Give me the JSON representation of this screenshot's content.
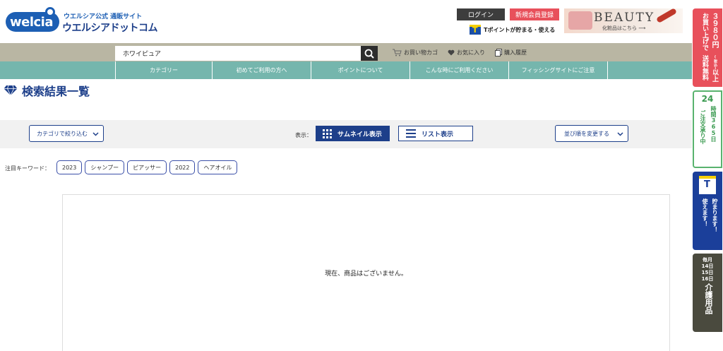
{
  "header": {
    "logo_text": "welcia",
    "logo_sub": "ウエルシア公式 通販サイト",
    "logo_main": "ウエルシアドットコム",
    "login_label": "ログイン",
    "register_label": "新規会員登録",
    "tpoint_text": "Tポイントが貯まる・使える",
    "beauty_title": "BEAUTY",
    "beauty_sub": "化粧品はこちら ⟶"
  },
  "search": {
    "value": "ホワイピュア"
  },
  "header_links": {
    "cart": "お買い物カゴ",
    "favorites": "お気に入り",
    "history": "購入履歴"
  },
  "nav": {
    "items": [
      {
        "label": "カテゴリー"
      },
      {
        "label": "初めてご利用の方へ"
      },
      {
        "label": "ポイントについて"
      },
      {
        "label": "こんな時にご利用ください"
      },
      {
        "label": "フィッシングサイトにご注意"
      }
    ]
  },
  "page": {
    "title": "検索結果一覧"
  },
  "filters": {
    "category_label": "カテゴリで絞り込む",
    "display_label": "表示：",
    "thumbnail_label": "サムネイル表示",
    "list_label": "リスト表示",
    "sort_label": "並び順を変更する"
  },
  "keywords": {
    "label": "注目キーワード：",
    "tags": [
      "2023",
      "シャンプー",
      "ピアッサー",
      "2022",
      "ヘアオイル"
    ]
  },
  "results": {
    "empty_message": "現在、商品はございません。"
  },
  "side": {
    "shipping": {
      "line1": "３９８０円",
      "tax": "(税込)",
      "line2": "以上",
      "line3": "お買い上げで",
      "line4": "送料無料"
    },
    "hours": {
      "num": "24",
      "line1": "時間365日",
      "line2": "ご注文承り中"
    },
    "tpoint": {
      "line1": "貯まります！",
      "line2": "使えます！"
    },
    "care": {
      "line1": "毎月",
      "line2": "14日",
      "line3": "15日",
      "line4": "16日",
      "line5": "介護用品"
    }
  },
  "colors": {
    "brand_blue": "#1d3f8a",
    "nav_teal": "#75b6ad",
    "search_bar": "#b9b6a3",
    "accent_red": "#e8505b"
  }
}
